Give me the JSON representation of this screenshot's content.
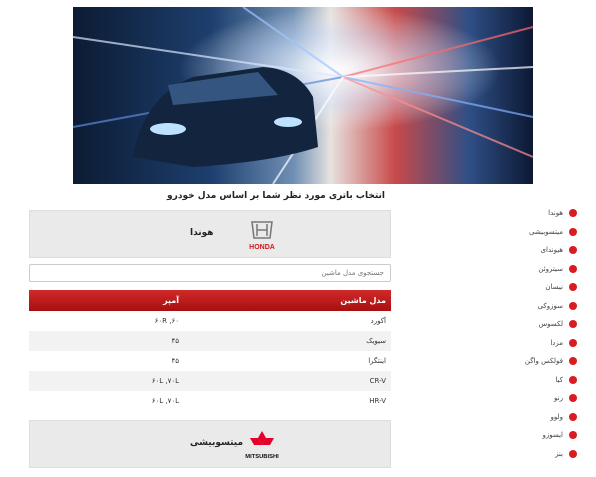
{
  "page": {
    "heading": "انتخاب باتری مورد نظر شما بر اساس مدل خودرو"
  },
  "brands": [
    {
      "name": "هوندا",
      "logo": "HONDA",
      "logo_icon": "honda-logo-icon"
    },
    {
      "name": "میتسوبیشی",
      "logo": "MITSUBISHI",
      "logo_icon": "mitsubishi-logo-icon"
    }
  ],
  "search": {
    "placeholder": "جستجوی مدل ماشین"
  },
  "table": {
    "headers": {
      "model": "مدل ماشین",
      "amp": "آمپر"
    },
    "rows": [
      {
        "model": "آکورد",
        "amp": "۶۰R ,۶۰"
      },
      {
        "model": "سیویک",
        "amp": "۴۵"
      },
      {
        "model": "اینتگرا",
        "amp": "۴۵"
      },
      {
        "model": "CR-V",
        "amp": "۶۰L ,۷۰L"
      },
      {
        "model": "HR-V",
        "amp": "۶۰L ,۷۰L"
      }
    ]
  },
  "sidebar": {
    "items": [
      {
        "label": "هوندا"
      },
      {
        "label": "میتسوبیشی"
      },
      {
        "label": "هیوندای"
      },
      {
        "label": "سیتروئن"
      },
      {
        "label": "نیسان"
      },
      {
        "label": "سوزوکی"
      },
      {
        "label": "لکسوس"
      },
      {
        "label": "مزدا"
      },
      {
        "label": "فولکس واگن"
      },
      {
        "label": "کیا"
      },
      {
        "label": "رنو"
      },
      {
        "label": "ولوو"
      },
      {
        "label": "ایسوزو"
      },
      {
        "label": "بنز"
      }
    ]
  },
  "colors": {
    "accent": "#c0181b",
    "dot": "#d91c22"
  }
}
